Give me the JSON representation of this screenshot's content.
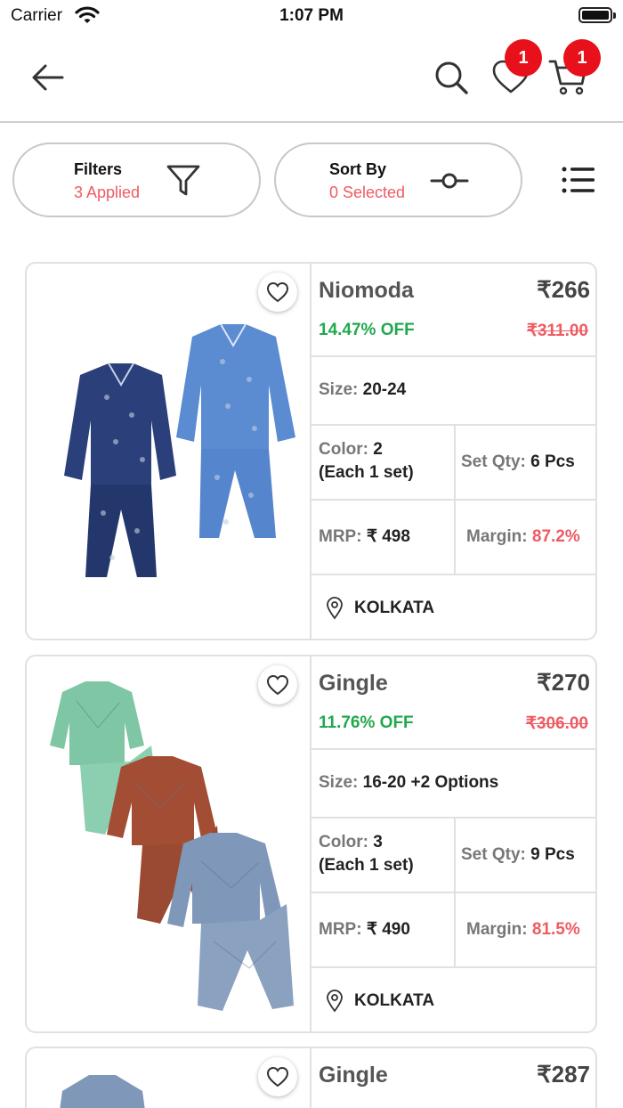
{
  "status_bar": {
    "carrier": "Carrier",
    "time": "1:07 PM"
  },
  "header": {
    "wishlist_count": "1",
    "cart_count": "1"
  },
  "filters": {
    "title": "Filters",
    "subtitle": "3 Applied"
  },
  "sort": {
    "title": "Sort By",
    "subtitle": "0 Selected"
  },
  "colors": {
    "accent_red": "#ef5b63",
    "discount_green": "#21a84d",
    "badge_red": "#e8101a"
  },
  "products": [
    {
      "brand": "Niomoda",
      "price": "₹266",
      "discount": "14.47% OFF",
      "original_price": "₹311.00",
      "size_label": "Size:",
      "size": "20-24",
      "color_label": "Color:",
      "color_count": "2",
      "color_note": "(Each 1 set)",
      "setqty_label": "Set Qty:",
      "setqty": "6 Pcs",
      "mrp_label": "MRP:",
      "mrp": "₹ 498",
      "margin_label": "Margin:",
      "margin": "87.2%",
      "location": "KOLKATA"
    },
    {
      "brand": "Gingle",
      "price": "₹270",
      "discount": "11.76% OFF",
      "original_price": "₹306.00",
      "size_label": "Size:",
      "size": "16-20 +2 Options",
      "color_label": "Color:",
      "color_count": "3",
      "color_note": "(Each 1 set)",
      "setqty_label": "Set Qty:",
      "setqty": "9 Pcs",
      "mrp_label": "MRP:",
      "mrp": "₹ 490",
      "margin_label": "Margin:",
      "margin": "81.5%",
      "location": "KOLKATA"
    },
    {
      "brand": "Gingle",
      "price": "₹287"
    }
  ]
}
